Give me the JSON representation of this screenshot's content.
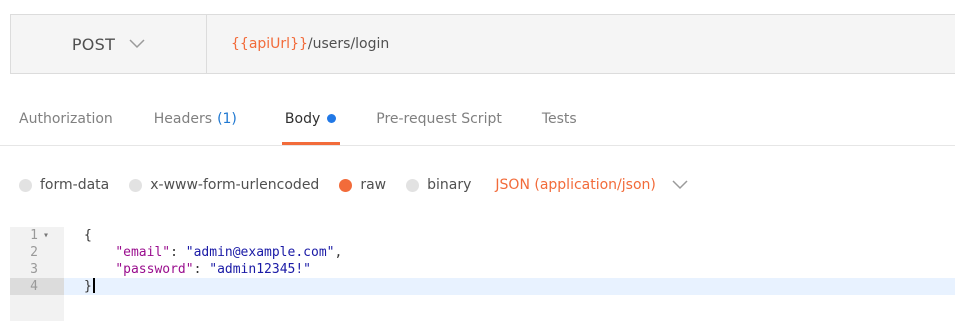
{
  "request": {
    "method": "POST",
    "url_variable": "{{apiUrl}}",
    "url_path": "/users/login"
  },
  "tabs": [
    {
      "label": "Authorization"
    },
    {
      "label": "Headers",
      "count": "(1)"
    },
    {
      "label": "Body",
      "active": true
    },
    {
      "label": "Pre-request Script"
    },
    {
      "label": "Tests"
    }
  ],
  "body_types": {
    "options": [
      "form-data",
      "x-www-form-urlencoded",
      "raw",
      "binary"
    ],
    "selected": "raw",
    "format": "JSON (application/json)"
  },
  "editor": {
    "line_numbers": [
      "1",
      "2",
      "3",
      "4"
    ],
    "lines": {
      "l1": "{",
      "l2_key": "\"email\"",
      "l2_sep": ": ",
      "l2_val": "\"admin@example.com\"",
      "l2_end": ",",
      "l3_key": "\"password\"",
      "l3_sep": ": ",
      "l3_val": "\"admin12345!\"",
      "l4": "}"
    },
    "active_line": 4
  },
  "colors": {
    "accent": "#f26b3a",
    "active_dot": "#2178e6",
    "count": "#1f78d1"
  },
  "icons": {
    "method_dropdown": "chevron-down-icon",
    "format_dropdown": "chevron-down-icon",
    "fold_marker": "fold-arrow-icon"
  }
}
